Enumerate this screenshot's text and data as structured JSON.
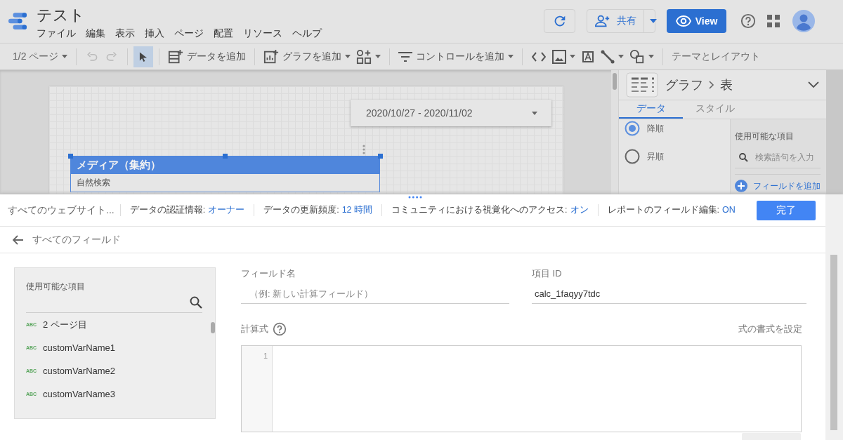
{
  "header": {
    "title": "テスト",
    "menu": [
      "ファイル",
      "編集",
      "表示",
      "挿入",
      "ページ",
      "配置",
      "リソース",
      "ヘルプ"
    ],
    "share_label": "共有",
    "view_label": "View"
  },
  "toolbar": {
    "page_selector": "1/2 ページ",
    "undo_disabled": true,
    "redo_disabled": true,
    "pointer_selected": true,
    "add_data": "データを追加",
    "add_chart": "グラフを追加",
    "add_control": "コントロールを追加",
    "theme": "テーマとレイアウト"
  },
  "canvas": {
    "date_range": "2020/10/27 - 2020/11/02",
    "table": {
      "title": "メディア（集約）",
      "rows": [
        "自然検索"
      ],
      "selected": true
    }
  },
  "side_panel": {
    "breadcrumb": [
      "グラフ",
      "表"
    ],
    "tabs": [
      {
        "label": "データ",
        "selected": true
      },
      {
        "label": "スタイル",
        "selected": false
      }
    ],
    "sort_options": [
      {
        "label": "降順",
        "selected": true
      },
      {
        "label": "昇順",
        "selected": false
      }
    ],
    "available_label": "使用可能な項目",
    "search_placeholder": "検索語句を入力",
    "add_field": "フィールドを追加"
  },
  "info_bar": {
    "data_source": "すべてのウェブサイト...",
    "items": [
      {
        "label": "データの認証情報:",
        "value": "オーナー"
      },
      {
        "label": "データの更新頻度:",
        "value": "12 時間"
      },
      {
        "label": "コミュニティにおける視覚化へのアクセス:",
        "value": "オン"
      },
      {
        "label": "レポートのフィールド編集:",
        "value": "ON"
      }
    ],
    "done": "完了"
  },
  "field_editor": {
    "back": "すべてのフィールド",
    "available_label": "使用可能な項目",
    "fields": [
      {
        "type": "ABC",
        "name": "2 ページ目"
      },
      {
        "type": "ABC",
        "name": "customVarName1"
      },
      {
        "type": "ABC",
        "name": "customVarName2"
      },
      {
        "type": "ABC",
        "name": "customVarName3"
      }
    ],
    "field_name_label": "フィールド名",
    "field_name_placeholder": "（例: 新しい計算フィールド）",
    "field_id_label": "項目 ID",
    "field_id_value": "calc_1faqyy7tdc",
    "formula_label": "計算式",
    "format_link": "式の書式を設定",
    "line_numbers": [
      "1"
    ]
  }
}
